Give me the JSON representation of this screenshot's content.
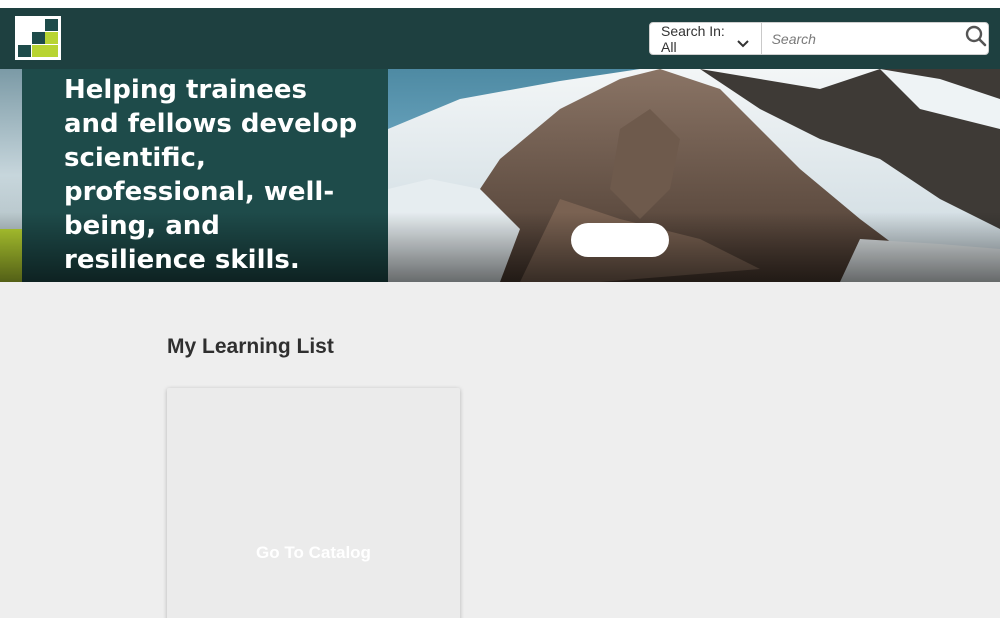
{
  "header": {
    "logo_icon": "site-logo-icon",
    "search_scope_label": "Search In: All",
    "search_placeholder": "Search",
    "colors": {
      "bar": "#1e4040",
      "logo_green": "#1e4b4a",
      "logo_lime": "#b8d432"
    }
  },
  "hero": {
    "headline": "Helping trainees and fellows develop scientific, professional, well-being, and resilience skills.",
    "cta_label": "",
    "colors": {
      "panel": "#1e4b4a",
      "accent": "#b8d432"
    }
  },
  "main": {
    "section_title": "My Learning List",
    "card": {
      "label": "Go To Catalog"
    }
  }
}
